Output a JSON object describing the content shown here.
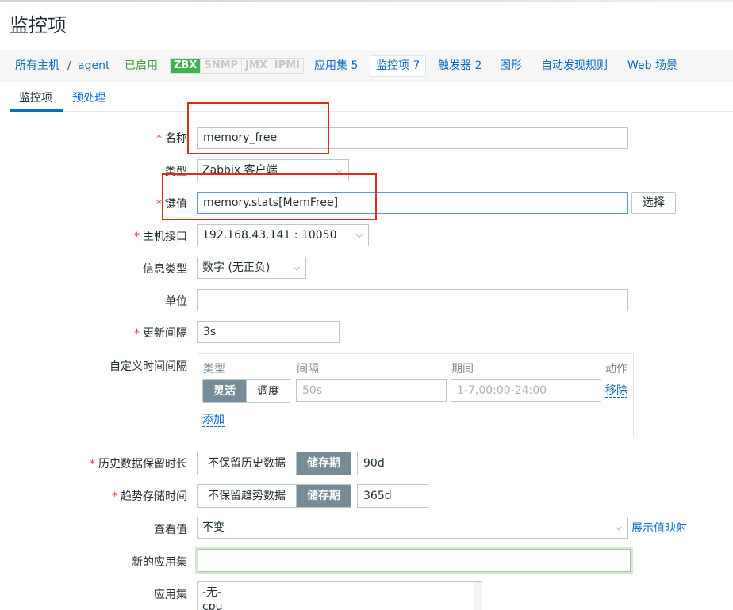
{
  "page": {
    "title": "监控项"
  },
  "nav": {
    "all_hosts": "所有主机",
    "sep": "/",
    "host": "agent",
    "status": "已启用",
    "badges": [
      "ZBX",
      "SNMP",
      "JMX",
      "IPMI"
    ],
    "applications": "应用集 5",
    "items": "监控项 7",
    "triggers": "触发器 2",
    "graphs": "图形",
    "discovery": "自动发现规则",
    "web": "Web 场景"
  },
  "subtabs": {
    "item": "监控项",
    "preprocessing": "预处理"
  },
  "form": {
    "name_label": "名称",
    "name_value": "memory_free",
    "type_label": "类型",
    "type_value": "Zabbix 客户端",
    "key_label": "键值",
    "key_value": "memory.stats[MemFree]",
    "select_button": "选择",
    "interface_label": "主机接口",
    "interface_value": "192.168.43.141 : 10050",
    "info_type_label": "信息类型",
    "info_type_value": "数字 (无正负)",
    "units_label": "单位",
    "units_value": "",
    "interval_label": "更新间隔",
    "interval_value": "3s",
    "custom_intervals_label": "自定义时间间隔",
    "custom": {
      "col_type": "类型",
      "col_interval": "间隔",
      "col_period": "期间",
      "col_action": "动作",
      "flexible": "灵活",
      "scheduling": "调度",
      "interval_placeholder": "50s",
      "period_placeholder": "1-7,00:00-24:00",
      "remove": "移除",
      "add": "添加"
    },
    "history_label": "历史数据保留时长",
    "history_no_keep": "不保留历史数据",
    "history_storage": "储存期",
    "history_value": "90d",
    "trends_label": "趋势存储时间",
    "trends_no_keep": "不保留趋势数据",
    "trends_storage": "储存期",
    "trends_value": "365d",
    "show_value_label": "查看值",
    "show_value_value": "不变",
    "show_value_link": "展示值映射",
    "new_app_label": "新的应用集",
    "new_app_value": "",
    "apps_label": "应用集",
    "apps_options": [
      "-无-",
      "cpu"
    ]
  }
}
